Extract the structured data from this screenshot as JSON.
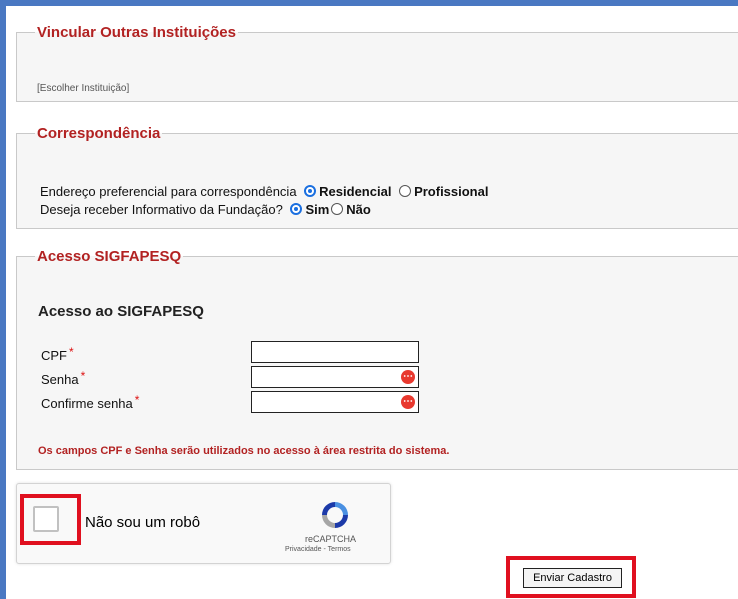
{
  "vincular": {
    "legend": "Vincular Outras Instituições",
    "link": "[Escolher Instituição]"
  },
  "correspondencia": {
    "legend": "Correspondência",
    "q1": {
      "label": "Endereço preferencial para correspondência",
      "options": [
        "Residencial",
        "Profissional"
      ],
      "selected": "Residencial"
    },
    "q2": {
      "label": "Deseja receber Informativo da Fundação?",
      "options": [
        "Sim",
        "Não"
      ],
      "selected": "Sim"
    }
  },
  "acesso": {
    "legend": "Acesso SIGFAPESQ",
    "title": "Acesso ao SIGFAPESQ",
    "fields": [
      {
        "label": "CPF",
        "value": ""
      },
      {
        "label": "Senha",
        "value": ""
      },
      {
        "label": "Confirme senha",
        "value": ""
      }
    ],
    "required_mark": "*",
    "note": "Os campos CPF e Senha serão utilizados no acesso à área restrita do sistema."
  },
  "recaptcha": {
    "label": "Não sou um robô",
    "brand": "reCAPTCHA",
    "terms": "Privacidade - Termos"
  },
  "submit": {
    "label": "Enviar Cadastro"
  },
  "colors": {
    "accent_blue": "#4a78c2",
    "legend_red": "#b22222",
    "highlight_red": "#e0101f"
  }
}
